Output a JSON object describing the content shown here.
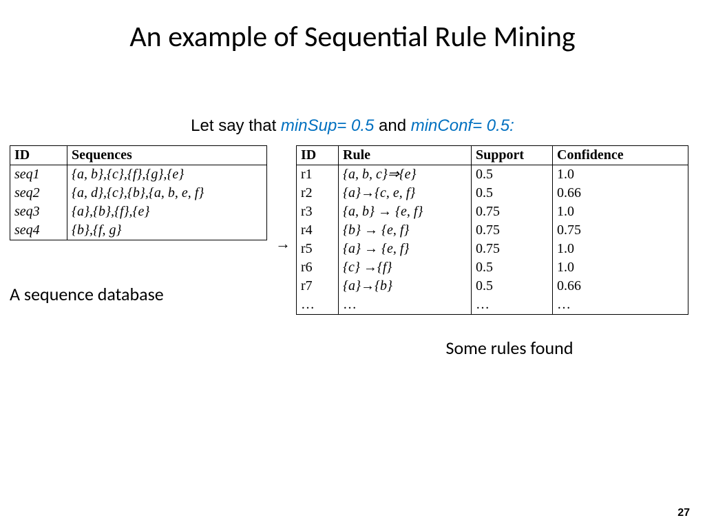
{
  "title": "An example of Sequential Rule Mining",
  "subtitle": {
    "prefix": "Let say that ",
    "p1": "minSup",
    "eq1": "= 0.5",
    "mid": " and ",
    "p2": "minConf",
    "eq2": "= 0.5:"
  },
  "seq_table": {
    "headers": [
      "ID",
      "Sequences"
    ],
    "rows": [
      {
        "id": "seq1",
        "seq": "{a, b},{c},{f},{g},{e}"
      },
      {
        "id": "seq2",
        "seq": "{a, d},{c},{b},{a, b, e, f}"
      },
      {
        "id": "seq3",
        "seq": "{a},{b},{f},{e}"
      },
      {
        "id": "seq4",
        "seq": "{b},{f, g}"
      }
    ]
  },
  "arrow": "→",
  "rules_table": {
    "headers": [
      "ID",
      "Rule",
      "Support",
      "Confidence"
    ],
    "rows": [
      {
        "id": "r1",
        "rule": "{a, b, c}⇒{e}",
        "support": "0.5",
        "confidence": "1.0"
      },
      {
        "id": "r2",
        "rule": "{a}→{c, e, f}",
        "support": "0.5",
        "confidence": "0.66"
      },
      {
        "id": "r3",
        "rule": "{a, b} → {e, f}",
        "support": "0.75",
        "confidence": "1.0"
      },
      {
        "id": "r4",
        "rule": "{b} → {e, f}",
        "support": "0.75",
        "confidence": "0.75"
      },
      {
        "id": "r5",
        "rule": "{a} → {e, f}",
        "support": "0.75",
        "confidence": "1.0"
      },
      {
        "id": "r6",
        "rule": "{c} →{f}",
        "support": "0.5",
        "confidence": "1.0"
      },
      {
        "id": "r7",
        "rule": "{a}→{b}",
        "support": "0.5",
        "confidence": "0.66"
      },
      {
        "id": "…",
        "rule": "…",
        "support": "…",
        "confidence": "…"
      }
    ]
  },
  "caption_left": "A sequence database",
  "caption_right": "Some rules found",
  "page_number": "27"
}
